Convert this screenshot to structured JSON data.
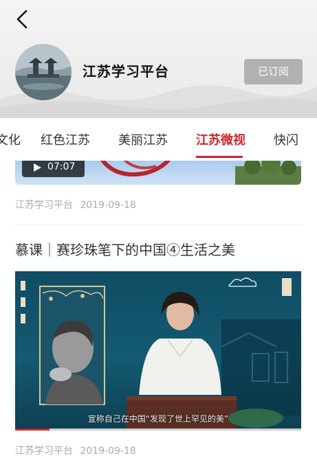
{
  "header": {
    "channel_name": "江苏学习平台",
    "subscribe_label": "已订阅"
  },
  "tabs": [
    {
      "label": "文化",
      "active": false
    },
    {
      "label": "红色江苏",
      "active": false
    },
    {
      "label": "美丽江苏",
      "active": false
    },
    {
      "label": "江苏微视",
      "active": true
    },
    {
      "label": "快闪",
      "active": false
    }
  ],
  "feed": {
    "items": [
      {
        "duration": "07:07",
        "source": "江苏学习平台",
        "date": "2019-09-18"
      },
      {
        "title": "慕课｜赛珍珠笔下的中国④生活之美",
        "caption": "宣称自己在中国“发现了世上罕见的美”",
        "source": "江苏学习平台",
        "date": "2019-09-18",
        "progress": 0.12
      }
    ]
  },
  "colors": {
    "accent": "#d2232a",
    "subscribed_button": "#b1b1b1",
    "meta_text": "#aaaaaa"
  },
  "icons": [
    "back-arrow-icon",
    "play-icon",
    "cloud-ornament-icon"
  ]
}
